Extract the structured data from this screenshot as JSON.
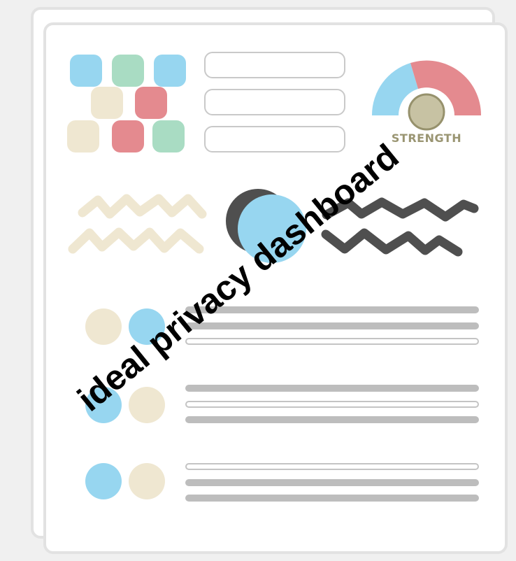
{
  "gauge": {
    "label": "STRENGTH"
  },
  "overlay": {
    "text": "ideal privacy dashboard"
  },
  "colors": {
    "blue": "#97d6f0",
    "green": "#a9dcc3",
    "beige": "#efe7d1",
    "red": "#e48a8f",
    "dark": "#4f4f4f",
    "gray": "#bdbdbd",
    "knob": "#c7c2a3",
    "knob_ring": "#96916c",
    "label": "#9a9572"
  },
  "password_tiles": [
    "blue",
    "green",
    "blue",
    "beige",
    "red",
    "beige",
    "red",
    "green"
  ],
  "list_rows": [
    {
      "dots": [
        "beige",
        "blue"
      ],
      "bars": [
        "solid",
        "solid",
        "outline"
      ]
    },
    {
      "dots": [
        "blue",
        "beige"
      ],
      "bars": [
        "solid",
        "outline",
        "solid"
      ]
    },
    {
      "dots": [
        "blue",
        "beige"
      ],
      "bars": [
        "outline",
        "solid",
        "solid"
      ]
    }
  ]
}
